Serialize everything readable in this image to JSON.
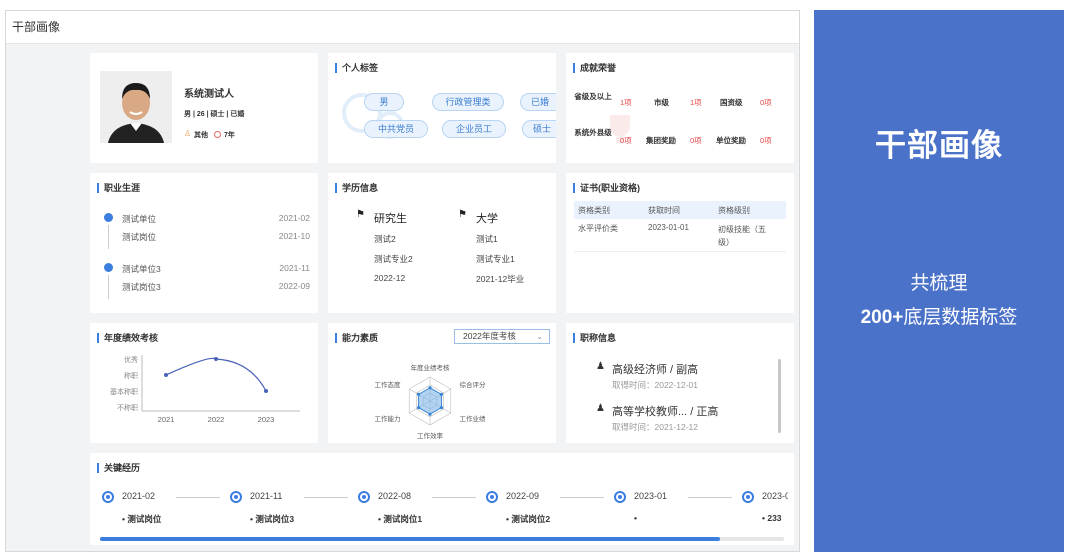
{
  "app_title": "干部画像",
  "profile": {
    "name": "系统测试人",
    "info": "男 | 26 | 硕士 | 已婚",
    "category": "其他",
    "years": "7年"
  },
  "tags": {
    "title": "个人标签",
    "items": [
      "男",
      "行政管理类",
      "已婚",
      "中共党员",
      "企业员工",
      "硕士"
    ]
  },
  "honors": {
    "title": "成就荣誉",
    "rows": [
      [
        {
          "label": "省级及以上",
          "value": "1项"
        },
        {
          "label": "市级",
          "value": "1项"
        },
        {
          "label": "国资级",
          "value": "0项"
        }
      ],
      [
        {
          "label": "系统外县级",
          "value": "0项"
        },
        {
          "label": "集团奖励",
          "value": "0项"
        },
        {
          "label": "单位奖励",
          "value": "0项"
        }
      ]
    ]
  },
  "career": {
    "title": "职业生涯",
    "items": [
      {
        "unit": "测试单位",
        "start": "2021-02",
        "post": "测试岗位",
        "end": "2021-10"
      },
      {
        "unit": "测试单位3",
        "start": "2021-11",
        "post": "测试岗位3",
        "end": "2022-09"
      }
    ]
  },
  "education": {
    "title": "学历信息",
    "items": [
      {
        "level": "研究生",
        "school": "测试2",
        "major": "测试专业2",
        "date": "2022-12"
      },
      {
        "level": "大学",
        "school": "测试1",
        "major": "测试专业1",
        "date": "2021-12毕业"
      }
    ]
  },
  "certificates": {
    "title": "证书(职业资格)",
    "headers": [
      "资格类别",
      "获取时间",
      "资格级别"
    ],
    "rows": [
      [
        "水平评价类",
        "2023-01-01",
        "初级技能（五级）"
      ]
    ]
  },
  "performance": {
    "title": "年度绩效考核",
    "y_ticks": [
      "优秀",
      "称职",
      "基本称职",
      "不称职"
    ],
    "x_ticks": [
      "2021",
      "2022",
      "2023"
    ]
  },
  "ability": {
    "title": "能力素质",
    "select": "2022年度考核",
    "axes": [
      "年度业绩考核",
      "综合评分",
      "工作业绩",
      "工作效率",
      "工作能力",
      "工作态度"
    ]
  },
  "titles": {
    "title": "职称信息",
    "items": [
      {
        "name": "高级经济师 / 副高",
        "date": "取得时间：2022-12-01"
      },
      {
        "name": "高等学校教师... / 正高",
        "date": "取得时间：2021-12-12"
      }
    ]
  },
  "key_exp": {
    "title": "关键经历",
    "items": [
      {
        "date": "2021-02",
        "post": "测试岗位"
      },
      {
        "date": "2021-11",
        "post": "测试岗位3"
      },
      {
        "date": "2022-08",
        "post": "测试岗位1"
      },
      {
        "date": "2022-09",
        "post": "测试岗位2"
      },
      {
        "date": "2023-01",
        "post": ""
      },
      {
        "date": "2023-0",
        "post": "233"
      }
    ]
  },
  "side": {
    "title": "干部画像",
    "line1": "共梳理",
    "line2_bold": "200+",
    "line2_rest": "底层数据标签"
  },
  "chart_data": [
    {
      "type": "line",
      "title": "年度绩效考核",
      "categories": [
        "2021",
        "2022",
        "2023"
      ],
      "y_categories": [
        "不称职",
        "基本称职",
        "称职",
        "优秀"
      ],
      "values": [
        "称职",
        "优秀",
        "基本称职"
      ]
    },
    {
      "type": "radar",
      "title": "能力素质",
      "axes": [
        "年度业绩考核",
        "综合评分",
        "工作业绩",
        "工作效率",
        "工作能力",
        "工作态度"
      ],
      "values": [
        0.55,
        0.55,
        0.55,
        0.55,
        0.55,
        0.55
      ]
    }
  ],
  "colors": {
    "accent": "#3a7ee0",
    "side_bg": "#4b72c9",
    "red": "#e54545"
  }
}
